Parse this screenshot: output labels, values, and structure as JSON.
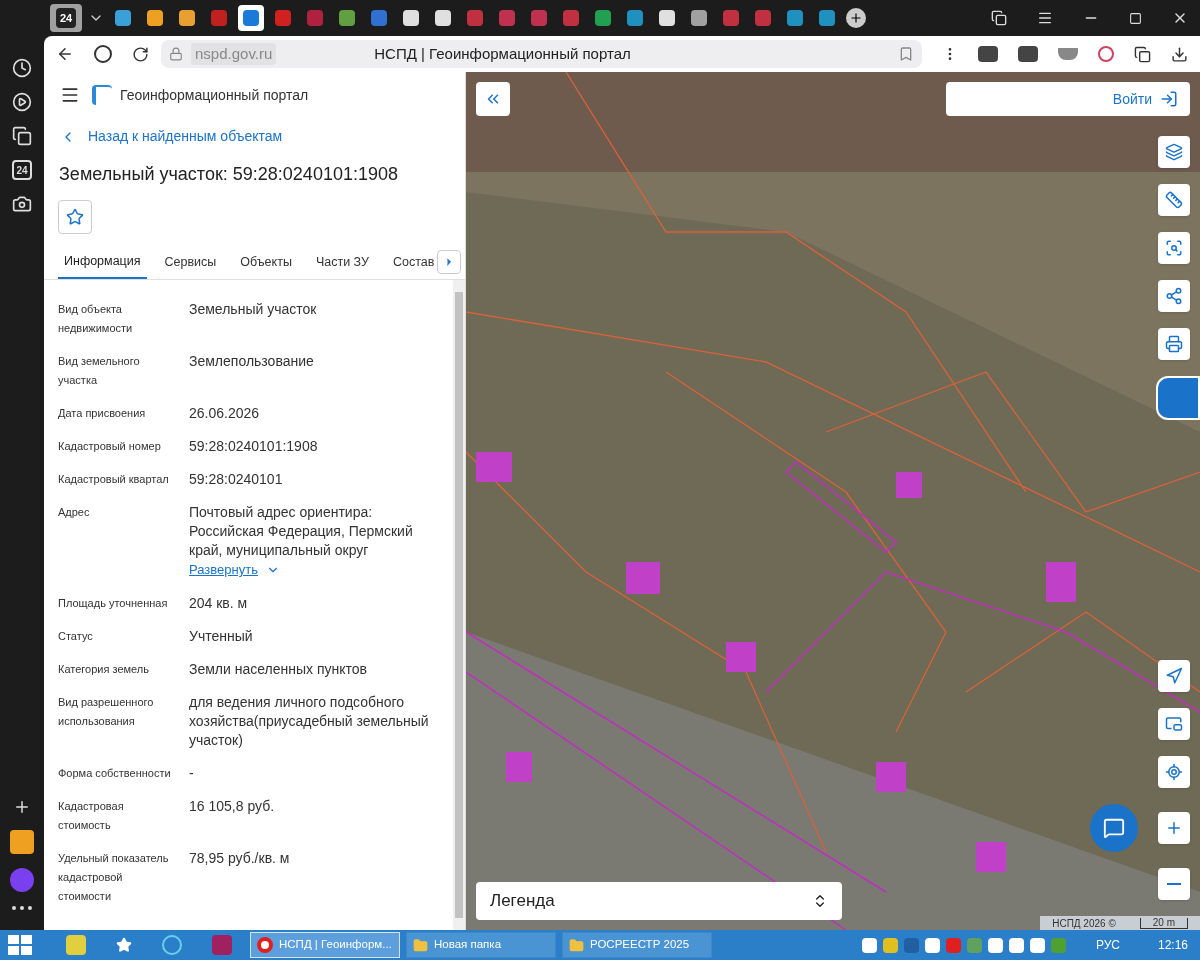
{
  "browser": {
    "url": "nspd.gov.ru",
    "page_title": "НСПД | Геоинформационный портал",
    "sidebar_badge": "24",
    "tab_badge": "24"
  },
  "portal": {
    "title": "Геоинформационный портал"
  },
  "panel": {
    "back_link": "Назад к найденным объектам",
    "heading": "Земельный участок: 59:28:0240101:1908",
    "favorite": false,
    "tabs": [
      {
        "label": "Информация",
        "selected": true
      },
      {
        "label": "Сервисы",
        "selected": false
      },
      {
        "label": "Объекты",
        "selected": false
      },
      {
        "label": "Части ЗУ",
        "selected": false
      },
      {
        "label": "Состав",
        "selected": false
      }
    ],
    "fields": [
      {
        "label": "Вид объекта недвижимости",
        "value": "Земельный участок"
      },
      {
        "label": "Вид земельного участка",
        "value": "Землепользование"
      },
      {
        "label": "Дата присвоения",
        "value": "26.06.2026"
      },
      {
        "label": "Кадастровый номер",
        "value": "59:28:0240101:1908"
      },
      {
        "label": "Кадастровый квартал",
        "value": "59:28:0240101"
      },
      {
        "label": "Адрес",
        "value": "Почтовый адрес ориентира: Российская Федерация, Пермский край, муниципальный округ",
        "expand_link": "Развернуть"
      },
      {
        "label": "Площадь уточненная",
        "value": "204 кв. м"
      },
      {
        "label": "Статус",
        "value": "Учтенный"
      },
      {
        "label": "Категория земель",
        "value": "Земли населенных пунктов"
      },
      {
        "label": "Вид разрешенного использования",
        "value": "для ведения личного подсобного хозяйства(приусадебный земельный участок)"
      },
      {
        "label": "Форма собственности",
        "value": "-"
      },
      {
        "label": "Кадастровая стоимость",
        "value": "16 105,8 руб."
      },
      {
        "label": "Удельный показатель кадастровой стоимости",
        "value": "78,95 руб./кв. м"
      }
    ]
  },
  "map": {
    "login_button": "Войти",
    "legend": "Легенда",
    "attribution": "НСПД 2026 ©",
    "scale": "20 m"
  },
  "taskbar": {
    "items": [
      {
        "label": "НСПД | Геоинформ...",
        "selected": true,
        "kind": "browser"
      },
      {
        "label": "Новая папка",
        "selected": false,
        "kind": "folder"
      },
      {
        "label": "РОСРЕЕСТР 2025",
        "selected": false,
        "kind": "folder"
      }
    ],
    "language": "РУС",
    "time": "12:16"
  }
}
